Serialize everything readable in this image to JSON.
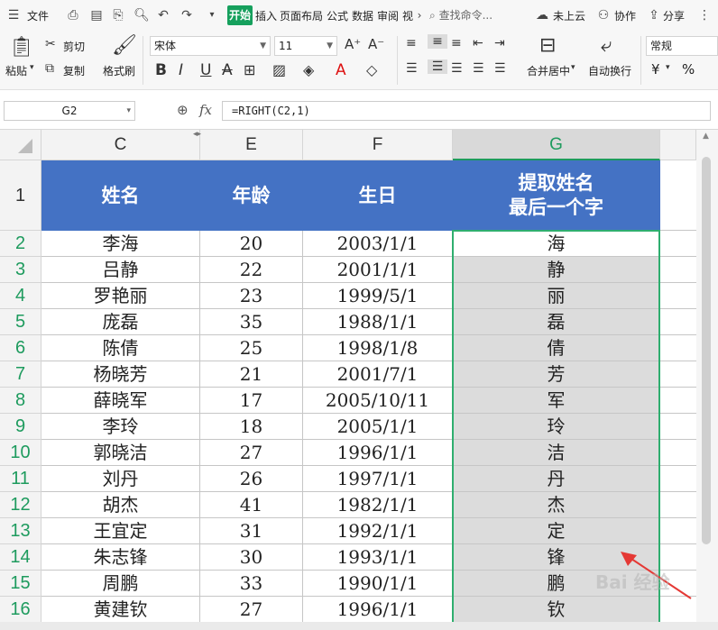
{
  "menubar": {
    "file_label": "文件",
    "start_tab": "开始",
    "tabs": [
      "插入",
      "页面布局",
      "公式",
      "数据",
      "审阅",
      "视"
    ],
    "more_icon": "chevron-right",
    "search_placeholder": "查找命令...",
    "cloud_label": "未上云",
    "collab_label": "协作",
    "share_label": "分享"
  },
  "ribbon": {
    "paste_label": "粘贴",
    "cut_label": "剪切",
    "copy_label": "复制",
    "format_painter_label": "格式刷",
    "font_name": "宋体",
    "font_size": "11",
    "merge_center_label": "合并居中",
    "wrap_text_label": "自动换行",
    "number_format": "常规",
    "currency_symbol": "¥",
    "percent_symbol": "%"
  },
  "formula_bar": {
    "name_box": "G2",
    "fx_label": "fx",
    "formula": "=RIGHT(C2,1)"
  },
  "columns": [
    "C",
    "E",
    "F",
    "G"
  ],
  "header_row": {
    "row_number": "1",
    "name": "姓名",
    "age": "年龄",
    "birthday": "生日",
    "extract_line1": "提取姓名",
    "extract_line2": "最后一个字"
  },
  "rows": [
    {
      "num": "2",
      "name": "李海",
      "age": "20",
      "birthday": "2003/1/1",
      "last": "海"
    },
    {
      "num": "3",
      "name": "吕静",
      "age": "22",
      "birthday": "2001/1/1",
      "last": "静"
    },
    {
      "num": "4",
      "name": "罗艳丽",
      "age": "23",
      "birthday": "1999/5/1",
      "last": "丽"
    },
    {
      "num": "5",
      "name": "庞磊",
      "age": "35",
      "birthday": "1988/1/1",
      "last": "磊"
    },
    {
      "num": "6",
      "name": "陈倩",
      "age": "25",
      "birthday": "1998/1/8",
      "last": "倩"
    },
    {
      "num": "7",
      "name": "杨晓芳",
      "age": "21",
      "birthday": "2001/7/1",
      "last": "芳"
    },
    {
      "num": "8",
      "name": "薛晓军",
      "age": "17",
      "birthday": "2005/10/11",
      "last": "军"
    },
    {
      "num": "9",
      "name": "李玲",
      "age": "18",
      "birthday": "2005/1/1",
      "last": "玲"
    },
    {
      "num": "10",
      "name": "郭晓洁",
      "age": "27",
      "birthday": "1996/1/1",
      "last": "洁"
    },
    {
      "num": "11",
      "name": "刘丹",
      "age": "26",
      "birthday": "1997/1/1",
      "last": "丹"
    },
    {
      "num": "12",
      "name": "胡杰",
      "age": "41",
      "birthday": "1982/1/1",
      "last": "杰"
    },
    {
      "num": "13",
      "name": "王宜定",
      "age": "31",
      "birthday": "1992/1/1",
      "last": "定"
    },
    {
      "num": "14",
      "name": "朱志锋",
      "age": "30",
      "birthday": "1993/1/1",
      "last": "锋"
    },
    {
      "num": "15",
      "name": "周鹏",
      "age": "33",
      "birthday": "1990/1/1",
      "last": "鹏"
    },
    {
      "num": "16",
      "name": "黄建钦",
      "age": "27",
      "birthday": "1996/1/1",
      "last": "钦"
    }
  ],
  "colors": {
    "header_fill": "#4472c4",
    "selection": "#2fae6f",
    "selected_fill": "#dcdcdc",
    "accent_green": "#16a05d"
  }
}
